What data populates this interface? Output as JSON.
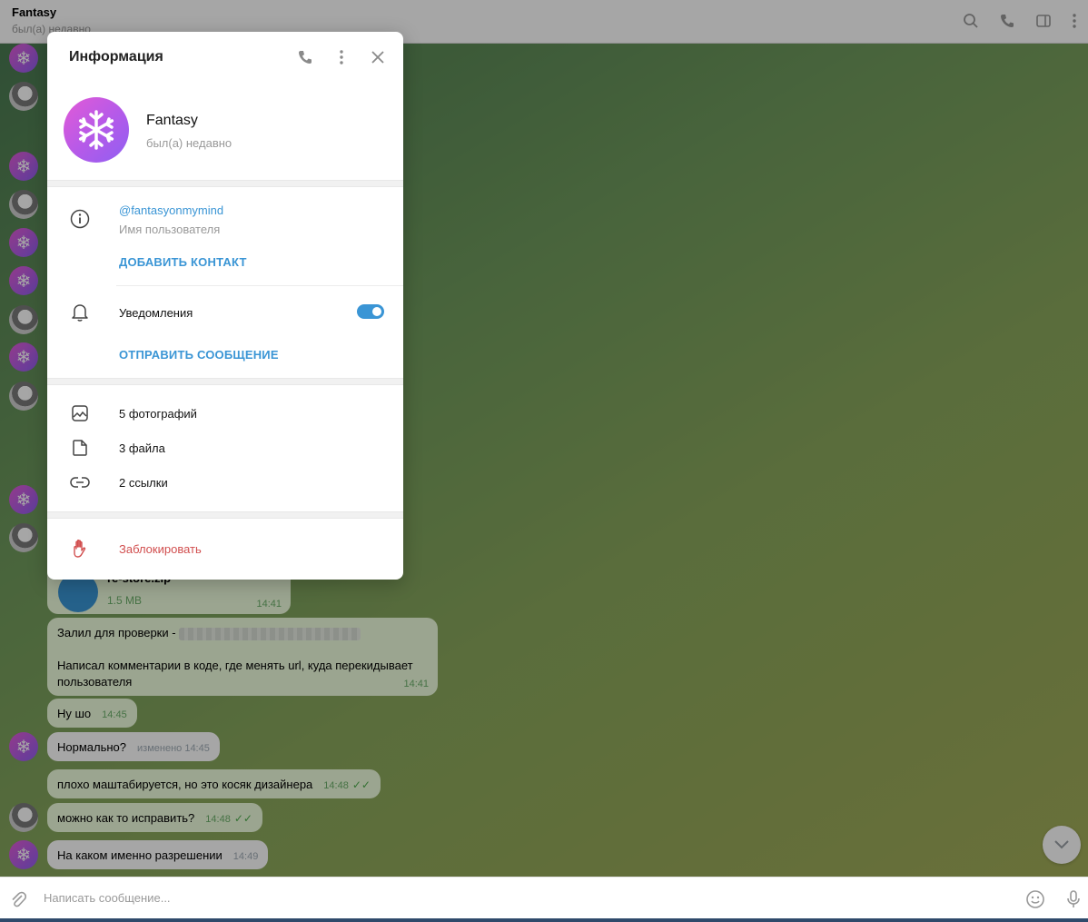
{
  "header": {
    "title": "Fantasy",
    "status": "был(а) недавно",
    "icons": [
      "search-icon",
      "phone-icon",
      "sidebar-toggle-icon",
      "more-icon"
    ]
  },
  "messages": [
    {
      "id": "file",
      "filename": "re-store.zip",
      "size": "1.5 MB",
      "time": "14:41"
    },
    {
      "id": "m1",
      "text_before": "Залил для проверки -",
      "text": "Написал комментарии в коде, где менять url, куда перекидывает пользователя",
      "time": "14:41"
    },
    {
      "id": "m2",
      "text": "Ну шо",
      "time": "14:45"
    },
    {
      "id": "m3",
      "text": "Нормально?",
      "time": "изменено 14:45"
    },
    {
      "id": "m4",
      "text": "плохо маштабируется, но это косяк дизайнера",
      "time": "14:48"
    },
    {
      "id": "m5",
      "text": "можно как то исправить?",
      "time": "14:48"
    },
    {
      "id": "m6",
      "text": "На каком именно разрешении",
      "time": "14:49"
    }
  ],
  "input": {
    "placeholder": "Написать сообщение..."
  },
  "panel": {
    "title": "Информация",
    "name": "Fantasy",
    "status": "был(а) недавно",
    "username": "@fantasyonmymind",
    "username_label": "Имя пользователя",
    "add_contact": "ДОБАВИТЬ КОНТАКТ",
    "notifications_label": "Уведомления",
    "notifications_on": true,
    "send_message": "ОТПРАВИТЬ СООБЩЕНИЕ",
    "media": [
      {
        "label": "5 фотографий",
        "icon": "photo-icon"
      },
      {
        "label": "3 файла",
        "icon": "file-icon"
      },
      {
        "label": "2 ссылки",
        "icon": "link-icon"
      }
    ],
    "block": "Заблокировать"
  },
  "colors": {
    "accent": "#3a95d5",
    "danger": "#d14e4e",
    "avatar_gradient_start": "#e35ad6",
    "avatar_gradient_end": "#8f5ff2"
  }
}
